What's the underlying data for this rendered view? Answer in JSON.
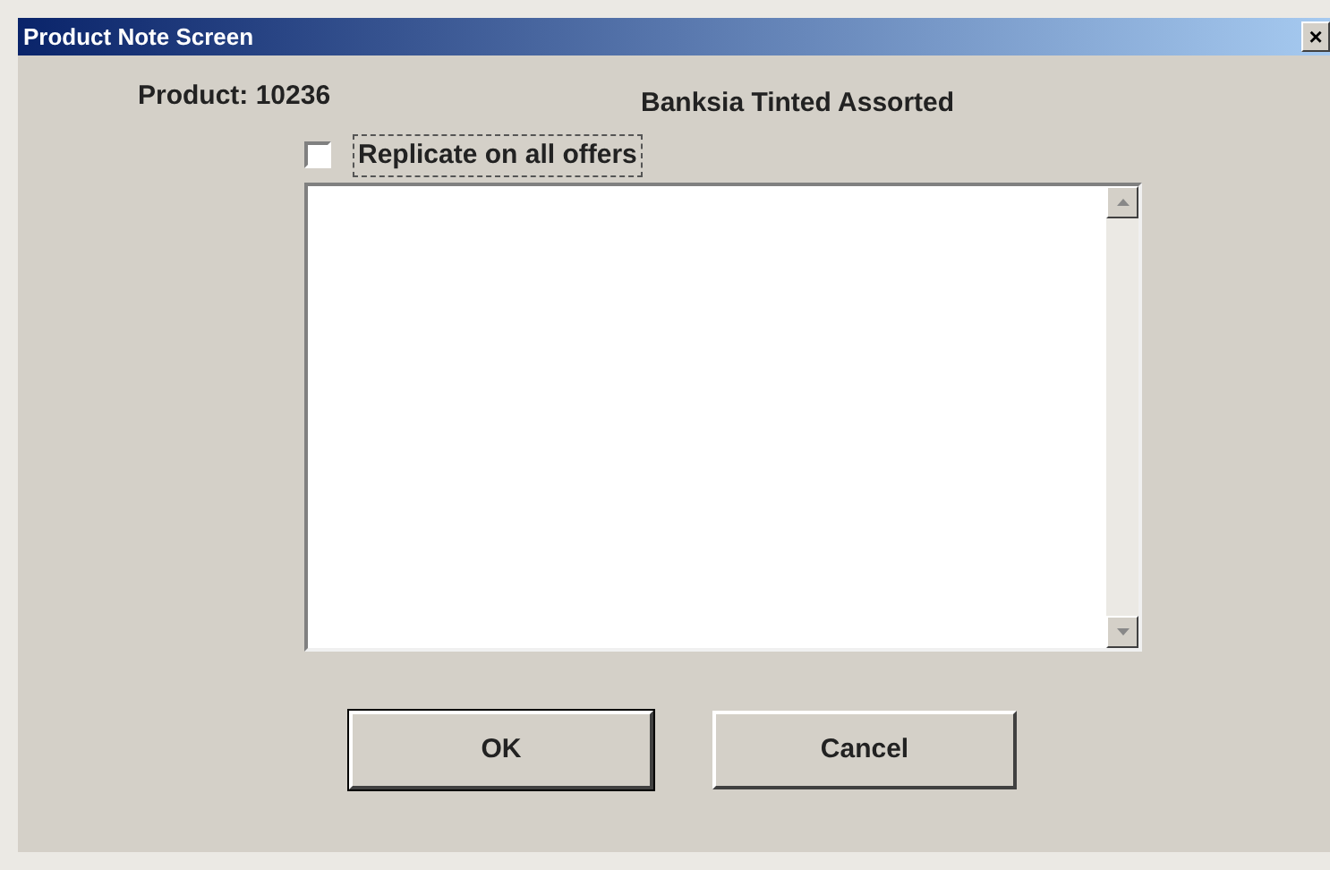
{
  "window": {
    "title": "Product Note Screen",
    "close": "×"
  },
  "product": {
    "label": "Product: 10236",
    "name": "Banksia Tinted Assorted"
  },
  "replicate": {
    "label": "Replicate on all offers",
    "checked": false,
    "focused": true
  },
  "buttons": [
    {
      "label": "OK",
      "default": true
    },
    {
      "label": "Cancel",
      "default": false
    }
  ]
}
